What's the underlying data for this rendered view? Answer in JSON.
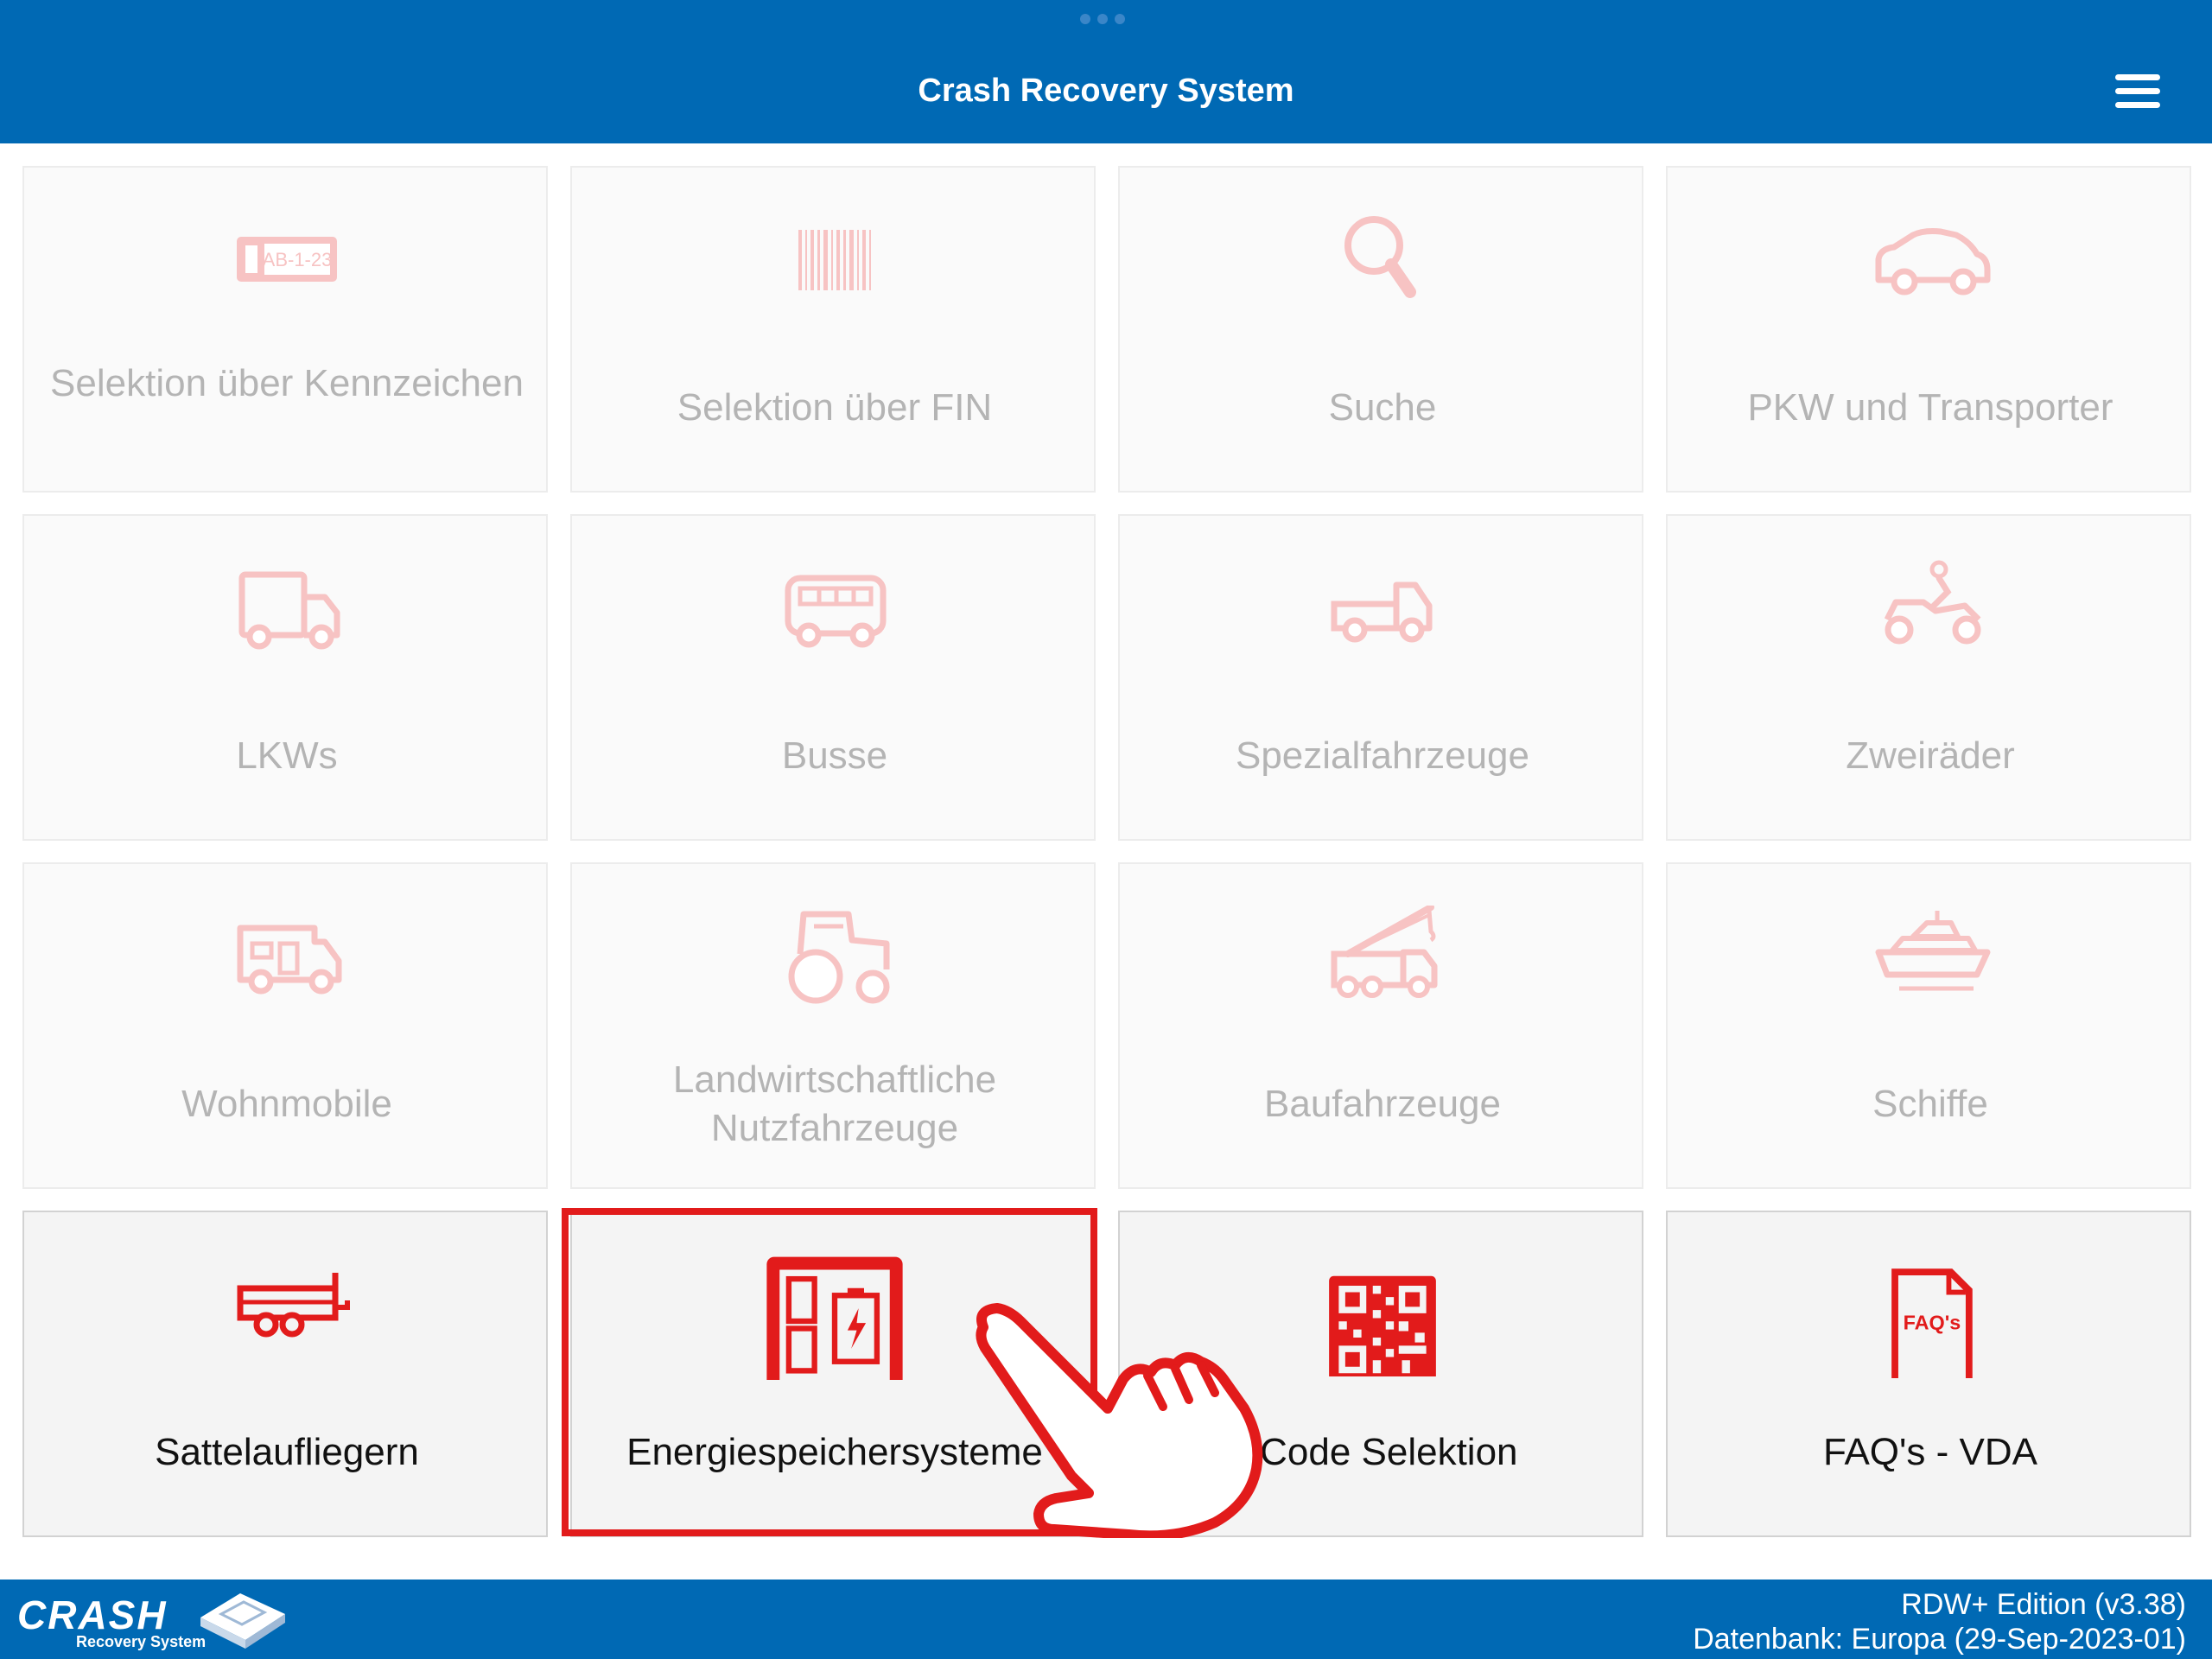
{
  "header": {
    "title": "Crash Recovery System"
  },
  "tiles": [
    {
      "label": "Selektion über Kennzeichen",
      "icon": "license-plate-icon",
      "plate_text": "AB-1-23",
      "active": false
    },
    {
      "label": "Selektion über FIN",
      "icon": "barcode-icon",
      "active": false
    },
    {
      "label": "Suche",
      "icon": "magnifier-icon",
      "active": false
    },
    {
      "label": "PKW und Transporter",
      "icon": "car-icon",
      "active": false
    },
    {
      "label": "LKWs",
      "icon": "truck-icon",
      "active": false
    },
    {
      "label": "Busse",
      "icon": "bus-icon",
      "active": false
    },
    {
      "label": "Spezialfahrzeuge",
      "icon": "special-vehicle-icon",
      "active": false
    },
    {
      "label": "Zweiräder",
      "icon": "motorcycle-icon",
      "active": false
    },
    {
      "label": "Wohnmobile",
      "icon": "camper-icon",
      "active": false
    },
    {
      "label": "Landwirtschaftliche Nutzfahrzeuge",
      "icon": "tractor-icon",
      "active": false
    },
    {
      "label": "Baufahrzeuge",
      "icon": "crane-truck-icon",
      "active": false
    },
    {
      "label": "Schiffe",
      "icon": "ship-icon",
      "active": false
    },
    {
      "label": "Sattelaufliegern",
      "icon": "trailer-icon",
      "active": true
    },
    {
      "label": "Energiespeichersysteme",
      "icon": "energy-storage-icon",
      "active": true
    },
    {
      "label": "-Code Selektion",
      "icon": "qr-code-icon",
      "active": true
    },
    {
      "label": "FAQ's - VDA",
      "icon": "faq-document-icon",
      "faq_text": "FAQ's",
      "active": true
    }
  ],
  "footer": {
    "logo_word": "CRASH",
    "logo_sub": "Recovery System",
    "edition": "RDW+ Edition (v3.38)",
    "database": "Datenbank: Europa (29-Sep-2023-01)"
  },
  "colors": {
    "brand_blue": "#0069b4",
    "accent_red": "#e21b1b",
    "disabled_icon": "#f7c3c3",
    "disabled_text": "#b4b4b4"
  }
}
